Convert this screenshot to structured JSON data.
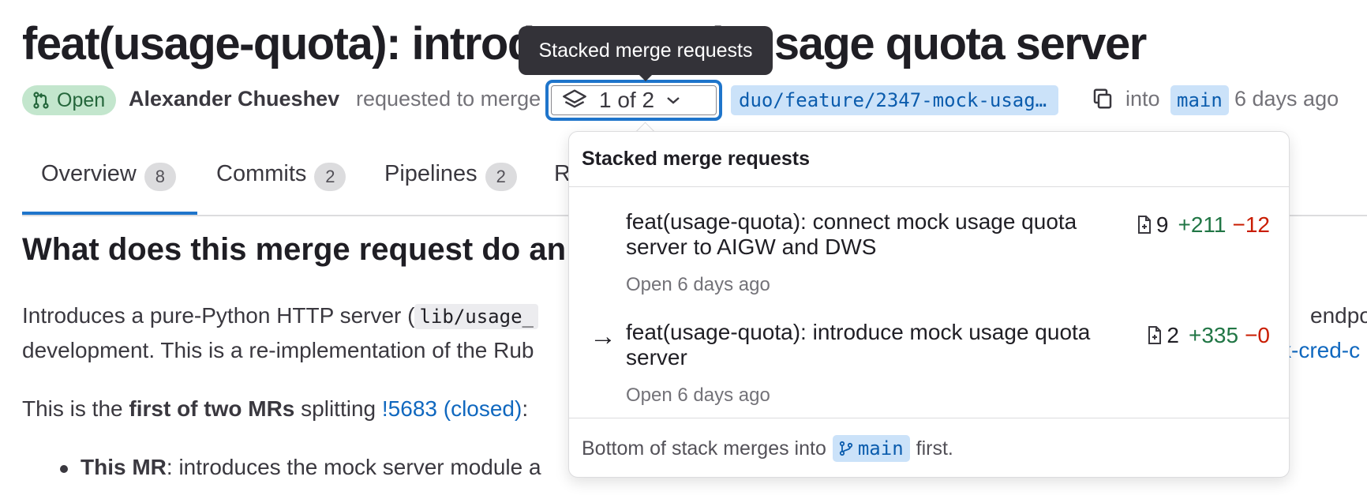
{
  "mr": {
    "title": "feat(usage-quota): introduce mock usage quota server",
    "status": "Open",
    "author": "Alexander Chueshev",
    "requested_text": "requested to merge",
    "stack_button_label": "1 of 2",
    "source_branch": "duo/feature/2347-mock-usag…",
    "into_text": "into",
    "target_branch": "main",
    "time_ago": "6 days ago"
  },
  "tooltip": {
    "text": "Stacked merge requests"
  },
  "tabs": [
    {
      "label": "Overview",
      "count": "8"
    },
    {
      "label": "Commits",
      "count": "2"
    },
    {
      "label": "Pipelines",
      "count": "2"
    },
    {
      "label": "R",
      "count": ""
    }
  ],
  "description": {
    "heading": "What does this merge request do an",
    "line1_pre": "Introduces a pure-Python HTTP server (",
    "line1_code": "lib/usage_",
    "line1_tail": "endpoin",
    "line2_pre": "development. This is a re-implementation of the Rub",
    "line2_link": "k-cred-c",
    "line3_pre": "This is the ",
    "line3_bold": "first of two MRs",
    "line3_mid": " splitting ",
    "line3_link": "!5683 (closed)",
    "line3_post": ":",
    "bullet1_bold": "This MR",
    "bullet1_text": ": introduces the mock server module a"
  },
  "dropdown": {
    "header": "Stacked merge requests",
    "items": [
      {
        "title": "feat(usage-quota): connect mock usage quota server to AIGW and DWS",
        "subtitle": "Open 6 days ago",
        "files": "9",
        "additions": "+211",
        "deletions": "−12",
        "current": false
      },
      {
        "title": "feat(usage-quota): introduce mock usage quota server",
        "subtitle": "Open 6 days ago",
        "files": "2",
        "additions": "+335",
        "deletions": "−0",
        "current": true
      }
    ],
    "footer_pre": "Bottom of stack merges into",
    "footer_branch": "main",
    "footer_post": "first."
  },
  "colors": {
    "link": "#1068bf",
    "focus": "#1f75cb",
    "open_badge_bg": "#c3e6cd",
    "additions": "#217645",
    "deletions": "#c91c00"
  }
}
